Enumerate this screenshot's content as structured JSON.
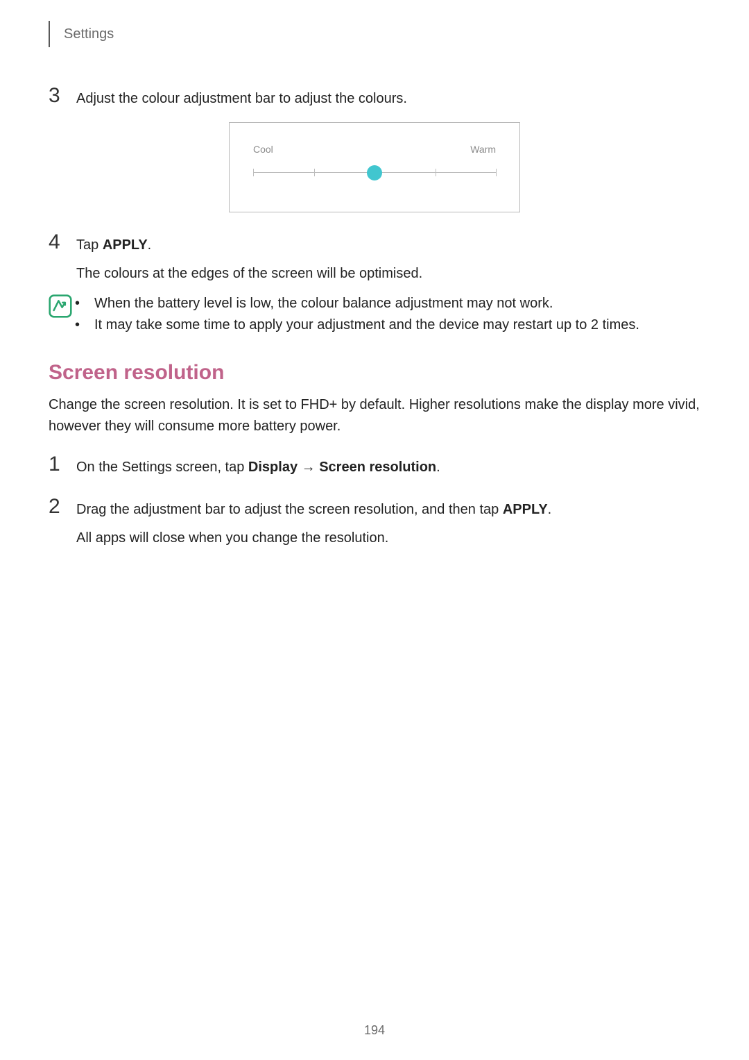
{
  "header": {
    "title": "Settings"
  },
  "steps_a": [
    {
      "num": "3",
      "text": "Adjust the colour adjustment bar to adjust the colours."
    }
  ],
  "slider": {
    "left_label": "Cool",
    "right_label": "Warm",
    "ticks_percent": [
      0,
      25,
      75,
      100
    ],
    "thumb_percent": 50
  },
  "step4": {
    "num": "4",
    "prefix": "Tap ",
    "bold": "APPLY",
    "suffix": ".",
    "sub": "The colours at the edges of the screen will be optimised."
  },
  "notes": [
    "When the battery level is low, the colour balance adjustment may not work.",
    "It may take some time to apply your adjustment and the device may restart up to 2 times."
  ],
  "section": {
    "title": "Screen resolution",
    "intro": "Change the screen resolution. It is set to FHD+ by default. Higher resolutions make the display more vivid, however they will consume more battery power."
  },
  "steps_b": {
    "s1": {
      "num": "1",
      "prefix": "On the Settings screen, tap ",
      "bold1": "Display",
      "arrow": " → ",
      "bold2": "Screen resolution",
      "suffix": "."
    },
    "s2": {
      "num": "2",
      "prefix": "Drag the adjustment bar to adjust the screen resolution, and then tap ",
      "bold": "APPLY",
      "suffix": ".",
      "sub": "All apps will close when you change the resolution."
    }
  },
  "page_number": "194"
}
